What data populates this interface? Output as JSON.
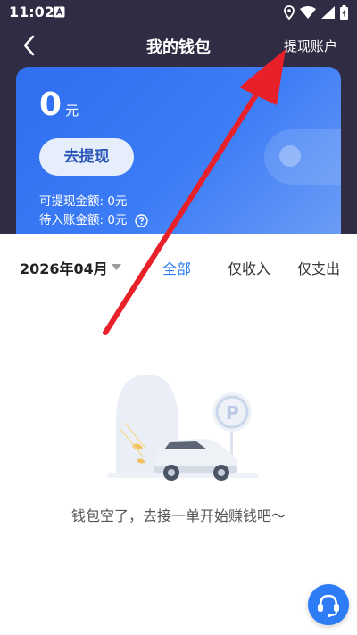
{
  "status_bar": {
    "time": "11:02"
  },
  "nav": {
    "title": "我的钱包",
    "right_label": "提现账户"
  },
  "card": {
    "balance": "0",
    "unit": "元",
    "withdraw_button": "去提现",
    "withdrawable": "可提现金额: 0元",
    "pending": "待入账金额: 0元"
  },
  "filter": {
    "month": "2026年04月",
    "tabs": {
      "all": "全部",
      "income": "仅收入",
      "expense": "仅支出"
    }
  },
  "empty_state": {
    "text": "钱包空了，去接一单开始赚钱吧～"
  },
  "colors": {
    "accent": "#2d7cf6",
    "header": "#2f2c44",
    "annotation_arrow": "#e8202a"
  }
}
